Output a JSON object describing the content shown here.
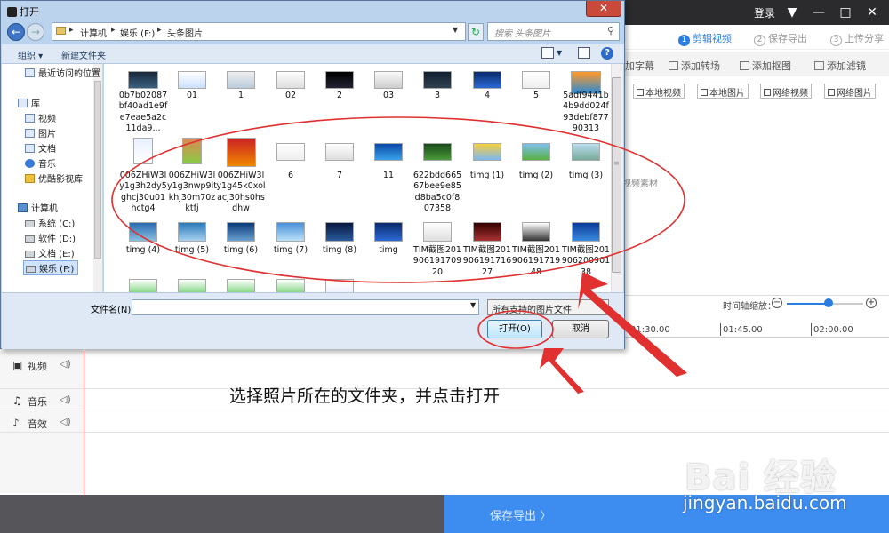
{
  "app": {
    "login": "登录",
    "steps": [
      {
        "num": "1",
        "label": "剪辑视频"
      },
      {
        "num": "2",
        "label": "保存导出"
      },
      {
        "num": "3",
        "label": "上传分享"
      }
    ],
    "tools": [
      "加字幕",
      "添加转场",
      "添加抠图",
      "添加滤镜"
    ],
    "media_buttons": [
      "本地视频",
      "本地图片",
      "网络视频",
      "网络图片"
    ],
    "empty_material": "视频素材",
    "zoom_label": "时间轴缩放：",
    "zoom_level": 0.55,
    "ruler": [
      "01:30.00",
      "01:45.00",
      "02:00.00"
    ],
    "tracks": [
      {
        "icon": "video-icon",
        "label": "视频"
      },
      {
        "icon": "music-icon",
        "label": "音乐"
      },
      {
        "icon": "sfx-icon",
        "label": "音效"
      }
    ],
    "export_label": "保存导出 〉"
  },
  "dialog": {
    "title": "打开",
    "close_glyph": "✕",
    "breadcrumbs": [
      "计算机",
      "娱乐 (F:)",
      "头条图片"
    ],
    "search_placeholder": "搜索 头条图片",
    "organize": "组织 ▾",
    "new_folder": "新建文件夹",
    "nav": {
      "recent": "最近访问的位置",
      "library": "库",
      "videos": "视频",
      "pictures": "图片",
      "documents": "文档",
      "music": "音乐",
      "youku": "优酷影视库",
      "computer": "计算机",
      "drive_c": "系统 (C:)",
      "drive_d": "软件 (D:)",
      "drive_e": "文档 (E:)",
      "drive_f": "娱乐 (F:)"
    },
    "files": [
      "0b7b02087bf40ad1e9fe7eae5a2c11da9...",
      "01",
      "1",
      "02",
      "2",
      "03",
      "3",
      "4",
      "5",
      "5adf9441b4b9dd024f93debf87790313",
      "006ZHiW3ly1g3h2dy5ghcj30u01hctg4",
      "006ZHiW3ly1g3nwp9itkhj30m70zktfj",
      "006ZHiW3ly1g45k0xolacj30hs0hsdhw",
      "6",
      "7",
      "11",
      "622bdd66567bee9e85d8ba5c0f807358",
      "timg (1)",
      "timg (2)",
      "timg (3)",
      "timg (4)",
      "timg (5)",
      "timg (6)",
      "timg (7)",
      "timg (8)",
      "timg",
      "TIM截图20190619170920",
      "TIM截图20190619171627",
      "TIM截图20190619171948",
      "TIM截图20190620090138"
    ],
    "filename_label": "文件名(N):",
    "filename_value": "",
    "filetype": "所有支持的图片文件",
    "open_button": "打开(O)",
    "cancel_button": "取消"
  },
  "annotation": {
    "instruction": "选择照片所在的文件夹，并点击打开",
    "color": "#e03030"
  },
  "watermark": {
    "brand": "Bai  经验",
    "url": "jingyan.baidu.com"
  }
}
